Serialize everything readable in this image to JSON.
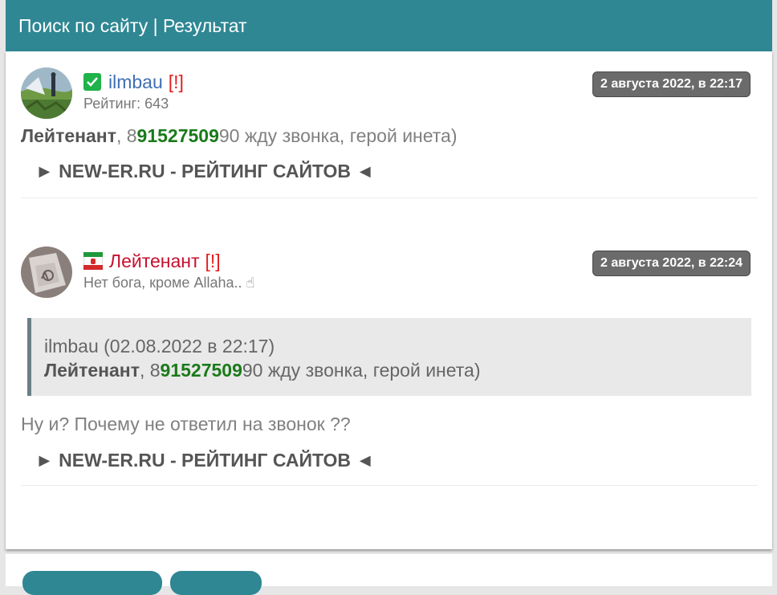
{
  "header": {
    "title": "Поиск по сайту | Результат"
  },
  "posts": [
    {
      "username": "ilmbau",
      "bang": "[!]",
      "subtitle": "Рейтинг: 643",
      "date": "2 августа 2022, в 22:17",
      "message": {
        "mention": "Лейтенант",
        "comma": ", ",
        "phone_pre": "8",
        "phone_mid": "91527509",
        "phone_post": "90",
        "rest": " жду звонка, герой инета)"
      },
      "link": "► NEW-ER.RU - РЕЙТИНГ САЙТОВ ◄"
    },
    {
      "username": "Лейтенант",
      "bang": "[!]",
      "subtitle": "Нет бога, кроме Allaha..  ☝",
      "date": "2 августа 2022, в 22:24",
      "quote": {
        "header": "ilmbau (02.08.2022 в 22:17)",
        "mention": "Лейтенант",
        "comma": ", ",
        "phone_pre": "8",
        "phone_mid": "91527509",
        "phone_post": "90",
        "rest": " жду звонка, герой инета)"
      },
      "message": "Ну и? Почему не ответил на звонок ??",
      "link": "► NEW-ER.RU - РЕЙТИНГ САЙТОВ ◄"
    }
  ],
  "colors": {
    "header_bg": "#2f8793",
    "username1": "#3f6fb5",
    "username2": "#c8102e",
    "phone": "#1a7a1a",
    "date_badge": "#6b6b6b"
  }
}
